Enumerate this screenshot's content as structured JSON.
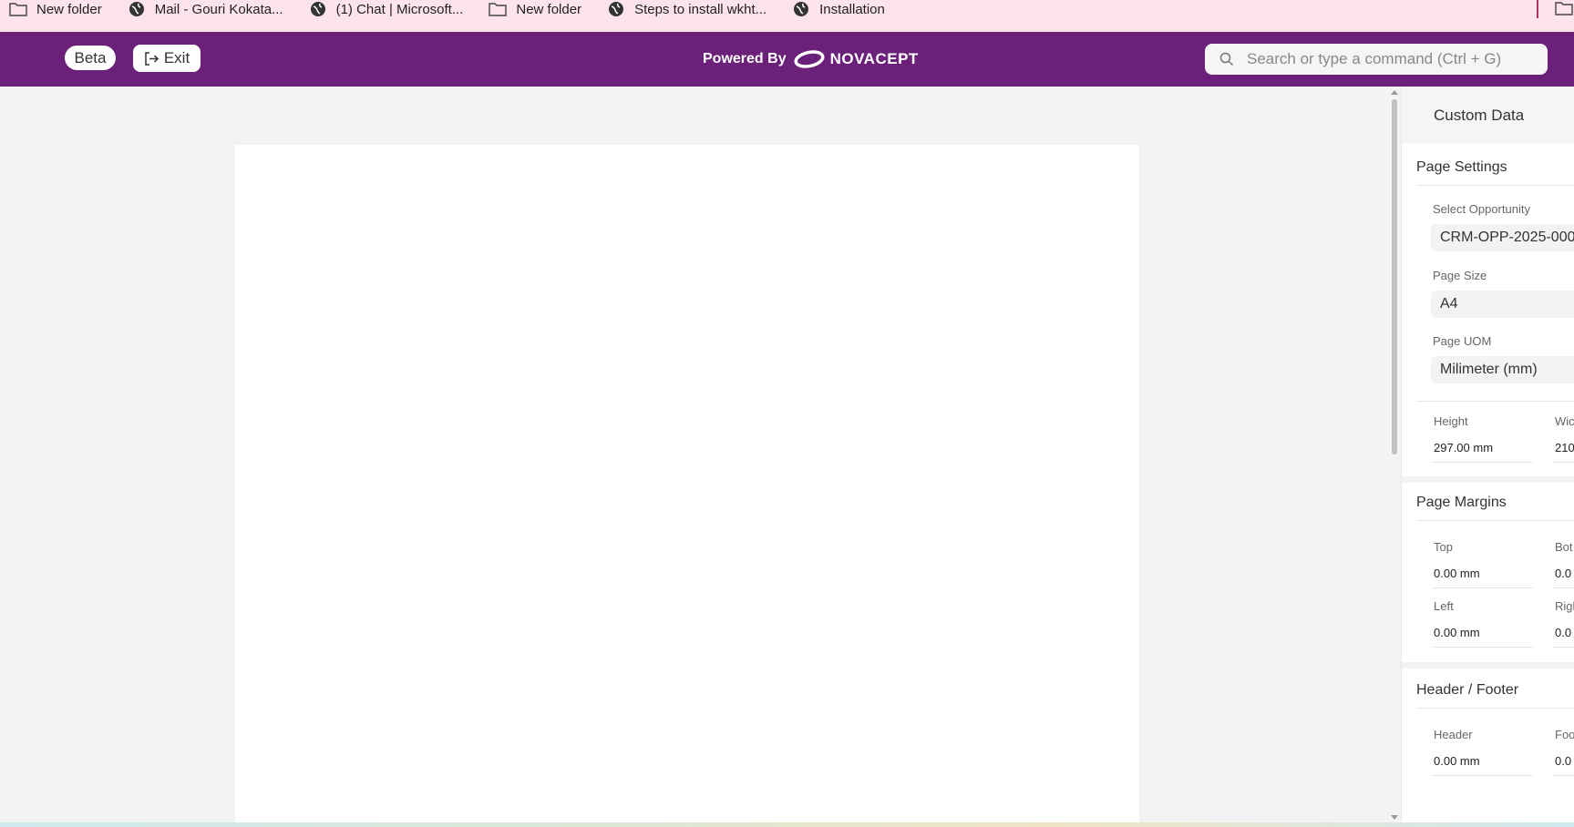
{
  "bookmarks": [
    {
      "icon": "folder-icon",
      "label": "New folder"
    },
    {
      "icon": "globe-icon",
      "label": "Mail - Gouri Kokata..."
    },
    {
      "icon": "globe-icon",
      "label": "(1) Chat | Microsoft..."
    },
    {
      "icon": "folder-icon",
      "label": "New folder"
    },
    {
      "icon": "globe-icon",
      "label": "Steps to install wkht..."
    },
    {
      "icon": "globe-icon",
      "label": "Installation"
    }
  ],
  "header": {
    "beta_label": "Beta",
    "exit_label": "Exit",
    "powered_by": "Powered By",
    "brand": "NOVACEPT",
    "search_placeholder": "Search or type a command (Ctrl + G)",
    "bg_color": "#6b207a"
  },
  "panel": {
    "title": "Custom Data",
    "page_settings": {
      "title": "Page Settings",
      "opportunity_label": "Select Opportunity",
      "opportunity_value": "CRM-OPP-2025-000",
      "size_label": "Page Size",
      "size_value": "A4",
      "uom_label": "Page UOM",
      "uom_value": "Milimeter (mm)",
      "height_label": "Height",
      "height_value": "297.00 mm",
      "width_label": "Wic",
      "width_value": "210"
    },
    "page_margins": {
      "title": "Page Margins",
      "top_label": "Top",
      "top_value": "0.00 mm",
      "bottom_label": "Bot",
      "bottom_value": "0.0",
      "left_label": "Left",
      "left_value": "0.00 mm",
      "right_label": "Righ",
      "right_value": "0.0"
    },
    "header_footer": {
      "title": "Header / Footer",
      "header_label": "Header",
      "header_value": "0.00 mm",
      "footer_label": "Foo",
      "footer_value": "0.0"
    }
  }
}
